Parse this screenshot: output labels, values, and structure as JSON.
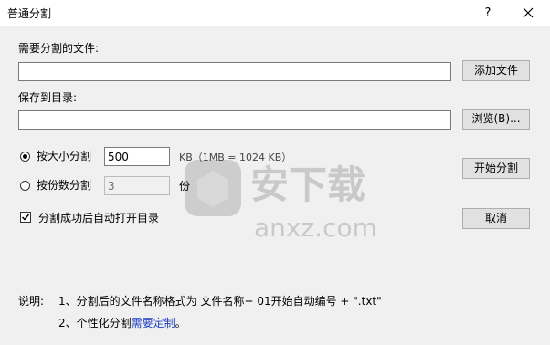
{
  "window": {
    "title": "普通分割",
    "help_glyph": "?",
    "close_icon": "close-icon"
  },
  "source": {
    "label": "需要分割的文件:",
    "value": "",
    "add_button": "添加文件"
  },
  "target": {
    "label": "保存到目录:",
    "value": "",
    "browse_button": "浏览(B)..."
  },
  "by_size": {
    "label": "按大小分割",
    "value": "500",
    "unit_note": "KB（1MB = 1024 KB）",
    "checked": true
  },
  "by_count": {
    "label": "按份数分割",
    "value": "3",
    "unit": "份",
    "checked": false
  },
  "open_after": {
    "label": "分割成功后自动打开目录",
    "checked": true
  },
  "actions": {
    "start": "开始分割",
    "cancel": "取消"
  },
  "notes": {
    "prefix": "说明:",
    "line1": "1、分割后的文件名称格式为   文件名称+ 01开始自动编号 + \".txt\"",
    "line2_prefix": "2、个性化分割",
    "line2_link": "需要定制",
    "line2_suffix": "。"
  },
  "watermark": {
    "text_cn": "安下载",
    "text_en": "anxz.com"
  }
}
